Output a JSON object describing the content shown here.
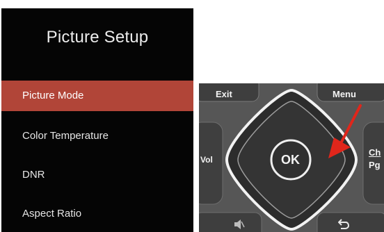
{
  "menu": {
    "title": "Picture Setup",
    "items": [
      {
        "label": "Picture Mode",
        "active": true
      },
      {
        "label": "Color Temperature",
        "active": false
      },
      {
        "label": "DNR",
        "active": false
      },
      {
        "label": "Aspect Ratio",
        "active": false
      }
    ],
    "colors": {
      "background": "#050505",
      "highlight": "#b14538",
      "text": "#e6e6e6"
    }
  },
  "remote": {
    "exit_label": "Exit",
    "menu_label": "Menu",
    "vol_label": "Vol",
    "ok_label": "OK",
    "ch_label": "Ch",
    "pg_label": "Pg",
    "mute_icon": "mute-icon",
    "back_icon": "return-icon",
    "pointer_color": "#e0261b"
  }
}
